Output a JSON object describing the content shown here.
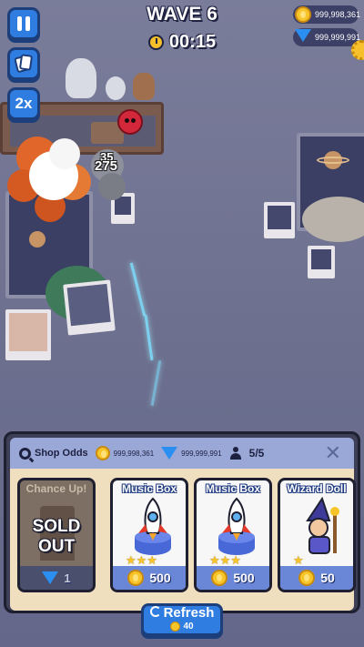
{
  "hud": {
    "wave_label": "WAVE 6",
    "timer": "00:15",
    "speed_label": "2x",
    "coins": "999,998,361",
    "gems": "999,999,991"
  },
  "battle": {
    "damage_numbers": [
      "35",
      "275"
    ]
  },
  "shop": {
    "odds_label": "Shop Odds",
    "coins": "999,998,361",
    "gems": "999,999,991",
    "slots": "5/5",
    "close_label": "✕",
    "cards": [
      {
        "title": "Chance Up!",
        "status": "SOLD OUT",
        "price": "1",
        "currency": "gem"
      },
      {
        "title": "Music Box",
        "stars": "★★★",
        "price": "500",
        "currency": "coin"
      },
      {
        "title": "Music Box",
        "stars": "★★★",
        "price": "500",
        "currency": "coin"
      },
      {
        "title": "Wizard Doll",
        "stars": "★",
        "price": "50",
        "currency": "coin"
      }
    ],
    "refresh_label": "Refresh",
    "refresh_cost": "40"
  },
  "colors": {
    "accent": "#2f7de1",
    "card_footer": "#6a86d6",
    "shop_header": "#9aa8d8",
    "gold": "#f7c52a"
  }
}
